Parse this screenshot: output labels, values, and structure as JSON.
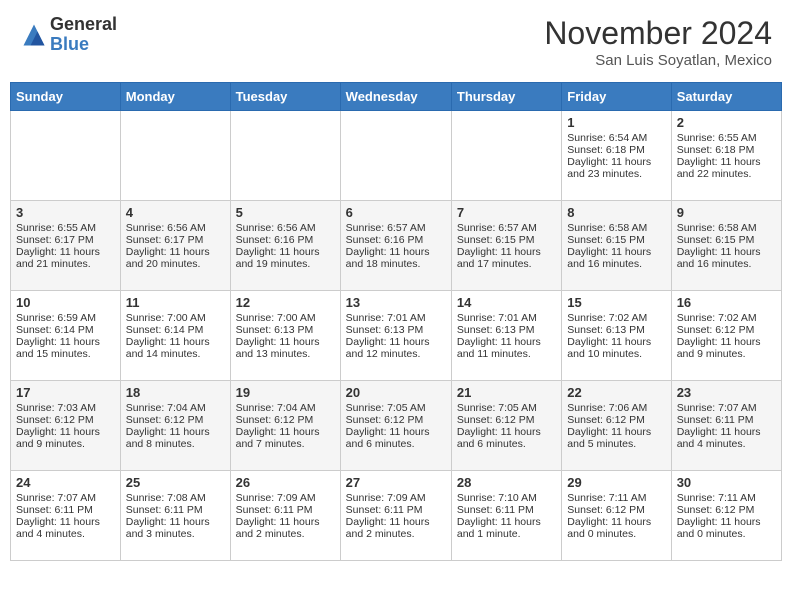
{
  "logo": {
    "general": "General",
    "blue": "Blue"
  },
  "title": "November 2024",
  "location": "San Luis Soyatlan, Mexico",
  "days_of_week": [
    "Sunday",
    "Monday",
    "Tuesday",
    "Wednesday",
    "Thursday",
    "Friday",
    "Saturday"
  ],
  "weeks": [
    [
      {
        "day": "",
        "info": ""
      },
      {
        "day": "",
        "info": ""
      },
      {
        "day": "",
        "info": ""
      },
      {
        "day": "",
        "info": ""
      },
      {
        "day": "",
        "info": ""
      },
      {
        "day": "1",
        "info": "Sunrise: 6:54 AM\nSunset: 6:18 PM\nDaylight: 11 hours and 23 minutes."
      },
      {
        "day": "2",
        "info": "Sunrise: 6:55 AM\nSunset: 6:18 PM\nDaylight: 11 hours and 22 minutes."
      }
    ],
    [
      {
        "day": "3",
        "info": "Sunrise: 6:55 AM\nSunset: 6:17 PM\nDaylight: 11 hours and 21 minutes."
      },
      {
        "day": "4",
        "info": "Sunrise: 6:56 AM\nSunset: 6:17 PM\nDaylight: 11 hours and 20 minutes."
      },
      {
        "day": "5",
        "info": "Sunrise: 6:56 AM\nSunset: 6:16 PM\nDaylight: 11 hours and 19 minutes."
      },
      {
        "day": "6",
        "info": "Sunrise: 6:57 AM\nSunset: 6:16 PM\nDaylight: 11 hours and 18 minutes."
      },
      {
        "day": "7",
        "info": "Sunrise: 6:57 AM\nSunset: 6:15 PM\nDaylight: 11 hours and 17 minutes."
      },
      {
        "day": "8",
        "info": "Sunrise: 6:58 AM\nSunset: 6:15 PM\nDaylight: 11 hours and 16 minutes."
      },
      {
        "day": "9",
        "info": "Sunrise: 6:58 AM\nSunset: 6:15 PM\nDaylight: 11 hours and 16 minutes."
      }
    ],
    [
      {
        "day": "10",
        "info": "Sunrise: 6:59 AM\nSunset: 6:14 PM\nDaylight: 11 hours and 15 minutes."
      },
      {
        "day": "11",
        "info": "Sunrise: 7:00 AM\nSunset: 6:14 PM\nDaylight: 11 hours and 14 minutes."
      },
      {
        "day": "12",
        "info": "Sunrise: 7:00 AM\nSunset: 6:13 PM\nDaylight: 11 hours and 13 minutes."
      },
      {
        "day": "13",
        "info": "Sunrise: 7:01 AM\nSunset: 6:13 PM\nDaylight: 11 hours and 12 minutes."
      },
      {
        "day": "14",
        "info": "Sunrise: 7:01 AM\nSunset: 6:13 PM\nDaylight: 11 hours and 11 minutes."
      },
      {
        "day": "15",
        "info": "Sunrise: 7:02 AM\nSunset: 6:13 PM\nDaylight: 11 hours and 10 minutes."
      },
      {
        "day": "16",
        "info": "Sunrise: 7:02 AM\nSunset: 6:12 PM\nDaylight: 11 hours and 9 minutes."
      }
    ],
    [
      {
        "day": "17",
        "info": "Sunrise: 7:03 AM\nSunset: 6:12 PM\nDaylight: 11 hours and 9 minutes."
      },
      {
        "day": "18",
        "info": "Sunrise: 7:04 AM\nSunset: 6:12 PM\nDaylight: 11 hours and 8 minutes."
      },
      {
        "day": "19",
        "info": "Sunrise: 7:04 AM\nSunset: 6:12 PM\nDaylight: 11 hours and 7 minutes."
      },
      {
        "day": "20",
        "info": "Sunrise: 7:05 AM\nSunset: 6:12 PM\nDaylight: 11 hours and 6 minutes."
      },
      {
        "day": "21",
        "info": "Sunrise: 7:05 AM\nSunset: 6:12 PM\nDaylight: 11 hours and 6 minutes."
      },
      {
        "day": "22",
        "info": "Sunrise: 7:06 AM\nSunset: 6:12 PM\nDaylight: 11 hours and 5 minutes."
      },
      {
        "day": "23",
        "info": "Sunrise: 7:07 AM\nSunset: 6:11 PM\nDaylight: 11 hours and 4 minutes."
      }
    ],
    [
      {
        "day": "24",
        "info": "Sunrise: 7:07 AM\nSunset: 6:11 PM\nDaylight: 11 hours and 4 minutes."
      },
      {
        "day": "25",
        "info": "Sunrise: 7:08 AM\nSunset: 6:11 PM\nDaylight: 11 hours and 3 minutes."
      },
      {
        "day": "26",
        "info": "Sunrise: 7:09 AM\nSunset: 6:11 PM\nDaylight: 11 hours and 2 minutes."
      },
      {
        "day": "27",
        "info": "Sunrise: 7:09 AM\nSunset: 6:11 PM\nDaylight: 11 hours and 2 minutes."
      },
      {
        "day": "28",
        "info": "Sunrise: 7:10 AM\nSunset: 6:11 PM\nDaylight: 11 hours and 1 minute."
      },
      {
        "day": "29",
        "info": "Sunrise: 7:11 AM\nSunset: 6:12 PM\nDaylight: 11 hours and 0 minutes."
      },
      {
        "day": "30",
        "info": "Sunrise: 7:11 AM\nSunset: 6:12 PM\nDaylight: 11 hours and 0 minutes."
      }
    ]
  ]
}
